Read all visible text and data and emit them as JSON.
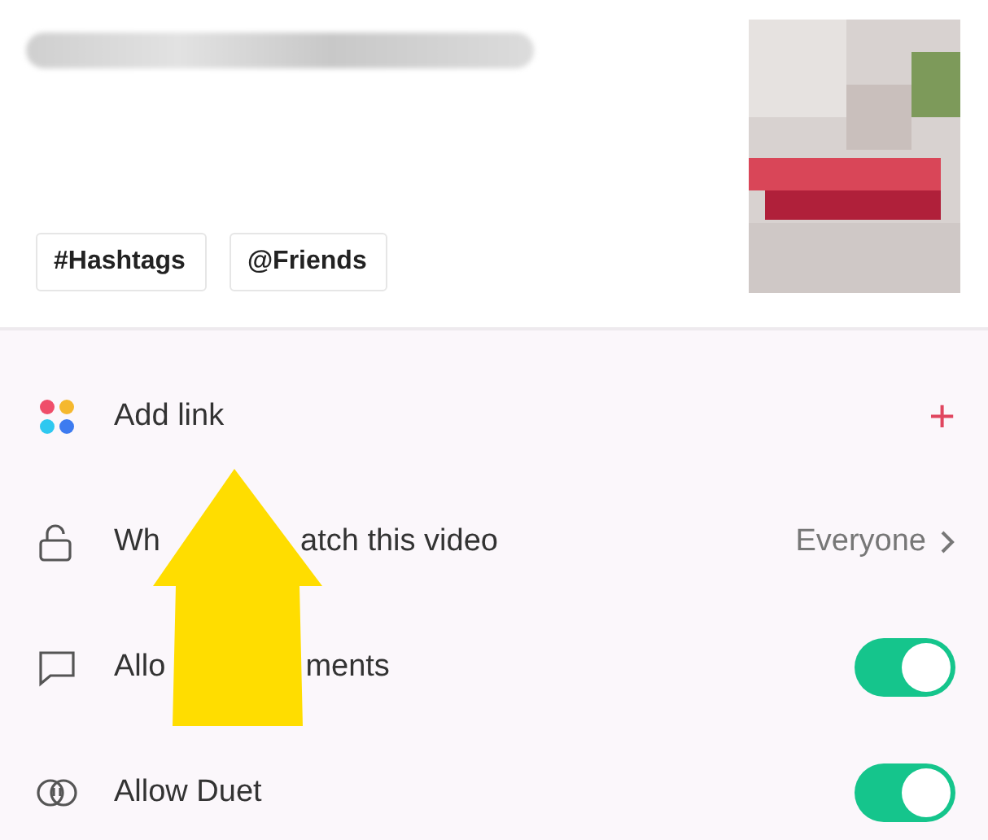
{
  "post": {
    "caption": {
      "kind": "blurred"
    },
    "chips": [
      {
        "symbol": "#",
        "label": "Hashtags"
      },
      {
        "symbol": "@",
        "label": "Friends"
      }
    ]
  },
  "settings": [
    {
      "kind": "link",
      "label": [
        "Add link"
      ],
      "action": "+"
    },
    {
      "kind": "select",
      "label": [
        "Wh",
        "atch this video"
      ],
      "value": "Everyone"
    },
    {
      "kind": "toggle",
      "label": [
        "Allo",
        "ments"
      ],
      "on": true
    },
    {
      "kind": "toggle",
      "label": [
        "Allow Duet"
      ],
      "on": true
    }
  ],
  "overlay": {
    "kind": "arrow"
  }
}
